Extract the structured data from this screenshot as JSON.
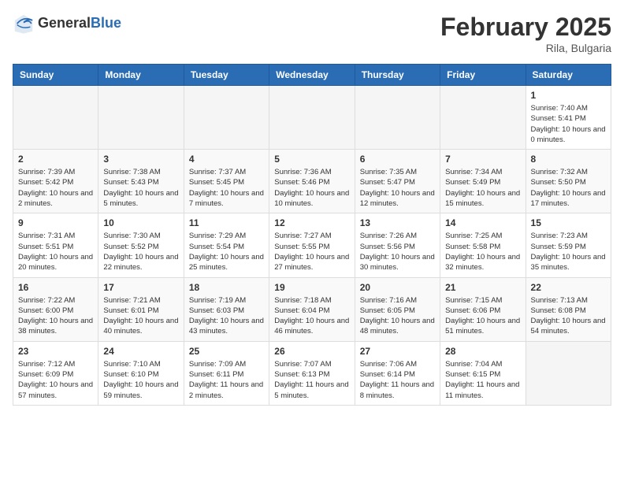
{
  "header": {
    "logo_general": "General",
    "logo_blue": "Blue",
    "month_year": "February 2025",
    "location": "Rila, Bulgaria"
  },
  "weekdays": [
    "Sunday",
    "Monday",
    "Tuesday",
    "Wednesday",
    "Thursday",
    "Friday",
    "Saturday"
  ],
  "weeks": [
    [
      null,
      null,
      null,
      null,
      null,
      null,
      {
        "day": "1",
        "sunrise": "7:40 AM",
        "sunset": "5:41 PM",
        "daylight": "10 hours and 0 minutes."
      }
    ],
    [
      {
        "day": "2",
        "sunrise": "7:39 AM",
        "sunset": "5:42 PM",
        "daylight": "10 hours and 2 minutes."
      },
      {
        "day": "3",
        "sunrise": "7:38 AM",
        "sunset": "5:43 PM",
        "daylight": "10 hours and 5 minutes."
      },
      {
        "day": "4",
        "sunrise": "7:37 AM",
        "sunset": "5:45 PM",
        "daylight": "10 hours and 7 minutes."
      },
      {
        "day": "5",
        "sunrise": "7:36 AM",
        "sunset": "5:46 PM",
        "daylight": "10 hours and 10 minutes."
      },
      {
        "day": "6",
        "sunrise": "7:35 AM",
        "sunset": "5:47 PM",
        "daylight": "10 hours and 12 minutes."
      },
      {
        "day": "7",
        "sunrise": "7:34 AM",
        "sunset": "5:49 PM",
        "daylight": "10 hours and 15 minutes."
      },
      {
        "day": "8",
        "sunrise": "7:32 AM",
        "sunset": "5:50 PM",
        "daylight": "10 hours and 17 minutes."
      }
    ],
    [
      {
        "day": "9",
        "sunrise": "7:31 AM",
        "sunset": "5:51 PM",
        "daylight": "10 hours and 20 minutes."
      },
      {
        "day": "10",
        "sunrise": "7:30 AM",
        "sunset": "5:52 PM",
        "daylight": "10 hours and 22 minutes."
      },
      {
        "day": "11",
        "sunrise": "7:29 AM",
        "sunset": "5:54 PM",
        "daylight": "10 hours and 25 minutes."
      },
      {
        "day": "12",
        "sunrise": "7:27 AM",
        "sunset": "5:55 PM",
        "daylight": "10 hours and 27 minutes."
      },
      {
        "day": "13",
        "sunrise": "7:26 AM",
        "sunset": "5:56 PM",
        "daylight": "10 hours and 30 minutes."
      },
      {
        "day": "14",
        "sunrise": "7:25 AM",
        "sunset": "5:58 PM",
        "daylight": "10 hours and 32 minutes."
      },
      {
        "day": "15",
        "sunrise": "7:23 AM",
        "sunset": "5:59 PM",
        "daylight": "10 hours and 35 minutes."
      }
    ],
    [
      {
        "day": "16",
        "sunrise": "7:22 AM",
        "sunset": "6:00 PM",
        "daylight": "10 hours and 38 minutes."
      },
      {
        "day": "17",
        "sunrise": "7:21 AM",
        "sunset": "6:01 PM",
        "daylight": "10 hours and 40 minutes."
      },
      {
        "day": "18",
        "sunrise": "7:19 AM",
        "sunset": "6:03 PM",
        "daylight": "10 hours and 43 minutes."
      },
      {
        "day": "19",
        "sunrise": "7:18 AM",
        "sunset": "6:04 PM",
        "daylight": "10 hours and 46 minutes."
      },
      {
        "day": "20",
        "sunrise": "7:16 AM",
        "sunset": "6:05 PM",
        "daylight": "10 hours and 48 minutes."
      },
      {
        "day": "21",
        "sunrise": "7:15 AM",
        "sunset": "6:06 PM",
        "daylight": "10 hours and 51 minutes."
      },
      {
        "day": "22",
        "sunrise": "7:13 AM",
        "sunset": "6:08 PM",
        "daylight": "10 hours and 54 minutes."
      }
    ],
    [
      {
        "day": "23",
        "sunrise": "7:12 AM",
        "sunset": "6:09 PM",
        "daylight": "10 hours and 57 minutes."
      },
      {
        "day": "24",
        "sunrise": "7:10 AM",
        "sunset": "6:10 PM",
        "daylight": "10 hours and 59 minutes."
      },
      {
        "day": "25",
        "sunrise": "7:09 AM",
        "sunset": "6:11 PM",
        "daylight": "11 hours and 2 minutes."
      },
      {
        "day": "26",
        "sunrise": "7:07 AM",
        "sunset": "6:13 PM",
        "daylight": "11 hours and 5 minutes."
      },
      {
        "day": "27",
        "sunrise": "7:06 AM",
        "sunset": "6:14 PM",
        "daylight": "11 hours and 8 minutes."
      },
      {
        "day": "28",
        "sunrise": "7:04 AM",
        "sunset": "6:15 PM",
        "daylight": "11 hours and 11 minutes."
      },
      null
    ]
  ]
}
